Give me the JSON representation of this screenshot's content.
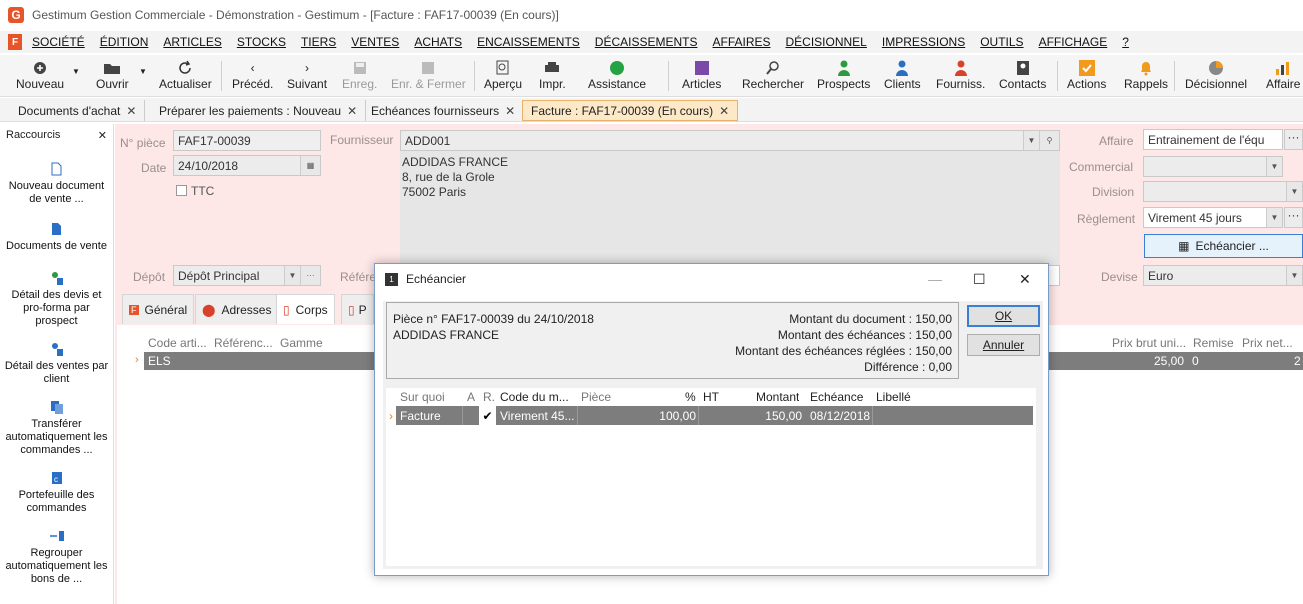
{
  "window": {
    "title": "Gestimum Gestion Commerciale - Démonstration - Gestimum - [Facture : FAF17-00039 (En cours)]",
    "logo": "G"
  },
  "menu": {
    "logo": "F",
    "items": [
      "SOCIÉTÉ",
      "ÉDITION",
      "ARTICLES",
      "STOCKS",
      "TIERS",
      "VENTES",
      "ACHATS",
      "ENCAISSEMENTS",
      "DÉCAISSEMENTS",
      "AFFAIRES",
      "DÉCISIONNEL",
      "IMPRESSIONS",
      "OUTILS",
      "AFFICHAGE",
      "?"
    ]
  },
  "toolbar": {
    "nouveau": "Nouveau",
    "ouvrir": "Ouvrir",
    "actualiser": "Actualiser",
    "preced": "Précéd.",
    "suivant": "Suivant",
    "enreg": "Enreg.",
    "enr_fermer": "Enr. & Fermer",
    "apercu": "Aperçu",
    "impr": "Impr.",
    "assistance": "Assistance",
    "articles": "Articles",
    "rechercher": "Rechercher",
    "prospects": "Prospects",
    "clients": "Clients",
    "fourniss": "Fourniss.",
    "contacts": "Contacts",
    "actions": "Actions",
    "rappels": "Rappels",
    "decisionnel": "Décisionnel",
    "affaire": "Affaire"
  },
  "tabs": [
    "Documents d'achat",
    "Préparer les paiements : Nouveau",
    "Echéances fournisseurs",
    "Facture : FAF17-00039 (En cours)"
  ],
  "sidebar": {
    "title": "Raccourcis",
    "items": [
      "Nouveau document de vente ...",
      "Documents de vente",
      "Détail des devis et pro-forma par prospect",
      "Détail des ventes par client",
      "Transférer automatiquement les commandes ...",
      "Portefeuille des commandes",
      "Regrouper automatiquement les bons de ..."
    ]
  },
  "form": {
    "num_piece_label": "N° pièce",
    "num_piece": "FAF17-00039",
    "date_label": "Date",
    "date": "24/10/2018",
    "ttc_label": "TTC",
    "fournisseur_label": "Fournisseur",
    "fournisseur": "ADD001",
    "addr1": "ADDIDAS FRANCE",
    "addr2": "8, rue de la Grole",
    "addr3": "75002 Paris",
    "affaire_label": "Affaire",
    "affaire": "Entrainement de l'équ",
    "commercial_label": "Commercial",
    "commercial": "",
    "division_label": "Division",
    "division": "",
    "reglement_label": "Règlement",
    "reglement": "Virement 45 jours",
    "echeancier_btn": "Echéancier ...",
    "depot_label": "Dépôt",
    "depot": "Dépôt Principal",
    "reference_label": "Référe",
    "devise_label": "Devise",
    "devise": "Euro"
  },
  "subtabs": [
    "Général",
    "Adresses",
    "Corps",
    "P"
  ],
  "grid": {
    "headers": [
      "Code arti...",
      "Référenc...",
      "Gamme",
      "Prix brut uni...",
      "Remise",
      "Prix net..."
    ],
    "row": {
      "code": "ELS",
      "prix": "25,00",
      "remise": "0",
      "net": "2"
    }
  },
  "dialog": {
    "title": "Echéancier",
    "piece": "Pièce n° FAF17-00039 du 24/10/2018",
    "tiers": "ADDIDAS FRANCE",
    "montant_doc": "Montant du document : 150,00",
    "montant_ech": "Montant des échéances : 150,00",
    "montant_regle": "Montant des échéances réglées : 150,00",
    "difference": "Différence : 0,00",
    "ok": "OK",
    "annuler": "Annuler",
    "headers": [
      "Sur quoi",
      "A",
      "R.",
      "Code du m...",
      "Pièce",
      "%",
      "HT",
      "Montant",
      "Echéance",
      "Libellé"
    ],
    "row": {
      "sur_quoi": "Facture",
      "a": "",
      "r": "✔",
      "code": "Virement 45...",
      "piece": "",
      "pct": "100,00",
      "ht": "",
      "montant": "150,00",
      "echeance": "08/12/2018",
      "libelle": ""
    }
  }
}
